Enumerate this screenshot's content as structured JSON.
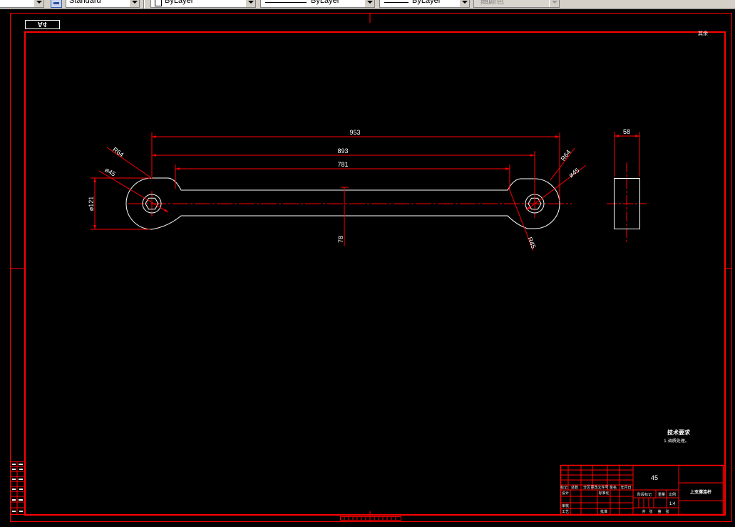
{
  "toolbar": {
    "text_style": {
      "value": "Standard",
      "icon": "text-style-icon"
    },
    "layer_color": {
      "value": "ByLayer"
    },
    "linetype": {
      "value": "ByLayer"
    },
    "lineweight": {
      "value": "ByLayer"
    },
    "plot_style": {
      "value": "随颜色"
    }
  },
  "colors": {
    "background": "#000000",
    "frame": "#ff0000",
    "geometry": "#ffffff",
    "toolbar": "#d4d0c8"
  },
  "sheet": {
    "size_label": "A4",
    "roughness_note": "其余"
  },
  "dimensions": {
    "overall_length": "953",
    "center_distance": "893",
    "body_length": "781",
    "side_thickness": "58",
    "boss_diameter": "ø121",
    "body_height": "78",
    "left_radius": "R64",
    "left_hole": "ø45",
    "right_radius": "R64",
    "right_hole": "ø45",
    "right_fillet": "R45"
  },
  "tech_requirements": {
    "heading": "技术要求",
    "items": [
      "1.调质处理。"
    ]
  },
  "title_block": {
    "material": "45",
    "part_name": "上支撑连杆",
    "scale_value": "1:4",
    "labels": {
      "mark": "标记",
      "count": "处数",
      "zone": "分区",
      "change_doc": "更改文件号",
      "signature": "签名",
      "date": "年月日",
      "design": "设计",
      "standardization": "标准化",
      "review": "审核",
      "process": "工艺",
      "approve": "批准",
      "stage_mark": "阶段标记",
      "weight": "重量",
      "scale": "比例",
      "total": "共",
      "sheets": "张",
      "sheet_no": "第",
      "sheet": "张"
    }
  }
}
